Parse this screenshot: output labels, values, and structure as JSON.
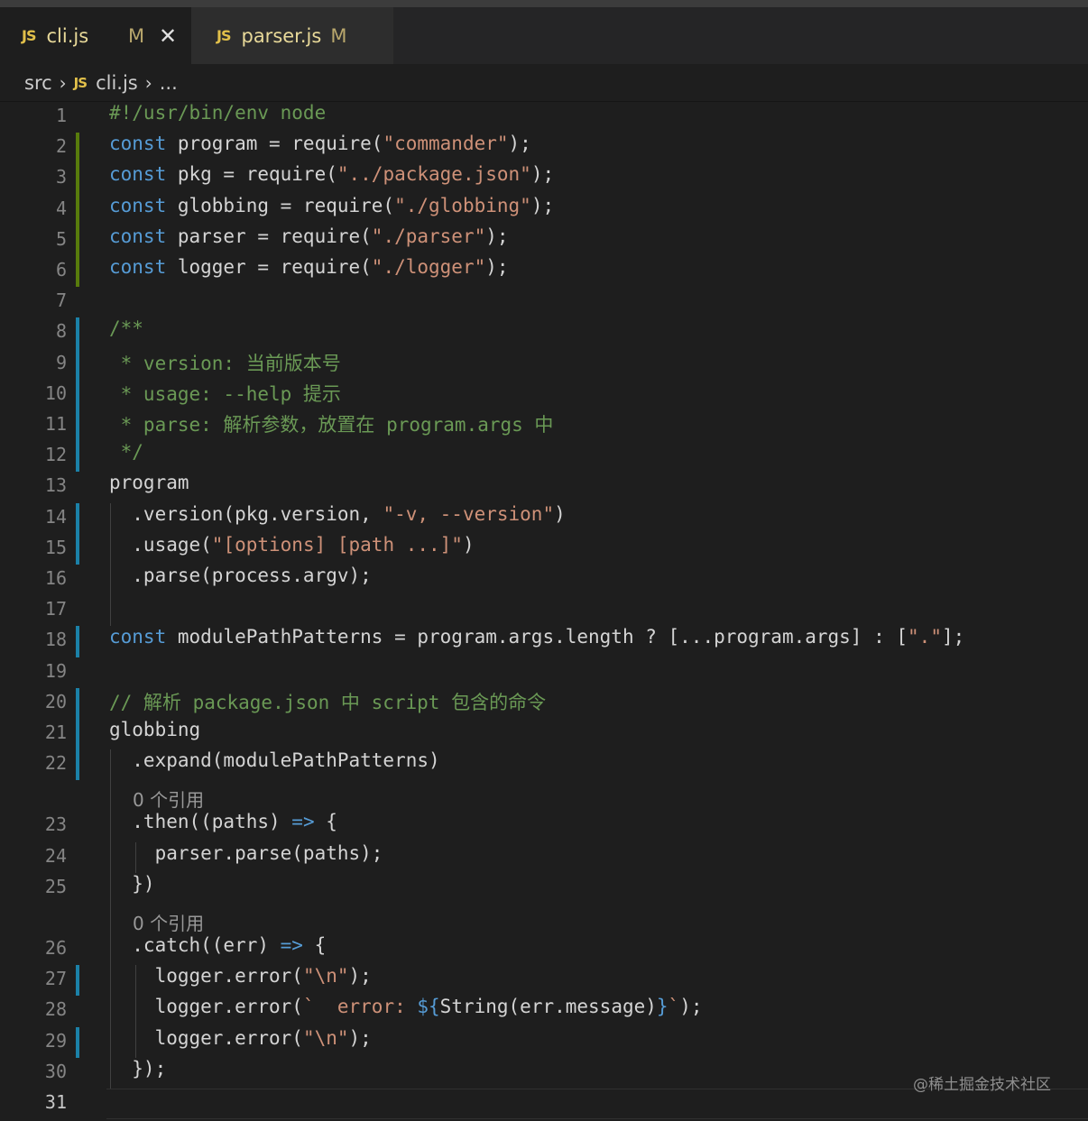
{
  "tabs": [
    {
      "icon": "JS",
      "label": "cli.js",
      "status": "M",
      "active": true
    },
    {
      "icon": "JS",
      "label": "parser.js",
      "status": "M",
      "active": false
    }
  ],
  "breadcrumb": {
    "folder": "src",
    "file": "cli.js",
    "more": "..."
  },
  "colors": {
    "keyword": "#569cd6",
    "string": "#ce9178",
    "comment": "#6a9955",
    "gutter_added": "#587c0c",
    "gutter_modified": "#1b81a8"
  },
  "editor": {
    "current_line": "31",
    "lines": [
      {
        "n": "1",
        "text": "#!/usr/bin/env node"
      },
      {
        "n": "2",
        "text": "const program = require(\"commander\");",
        "gutter": "added"
      },
      {
        "n": "3",
        "text": "const pkg = require(\"../package.json\");",
        "gutter": "added"
      },
      {
        "n": "4",
        "text": "const globbing = require(\"./globbing\");",
        "gutter": "added"
      },
      {
        "n": "5",
        "text": "const parser = require(\"./parser\");",
        "gutter": "added"
      },
      {
        "n": "6",
        "text": "const logger = require(\"./logger\");",
        "gutter": "added"
      },
      {
        "n": "7",
        "text": ""
      },
      {
        "n": "8",
        "text": "/**",
        "gutter": "modified"
      },
      {
        "n": "9",
        "text": " * version: 当前版本号",
        "gutter": "modified"
      },
      {
        "n": "10",
        "text": " * usage: --help 提示",
        "gutter": "modified"
      },
      {
        "n": "11",
        "text": " * parse: 解析参数，放置在 program.args 中",
        "gutter": "modified"
      },
      {
        "n": "12",
        "text": " */",
        "gutter": "modified"
      },
      {
        "n": "13",
        "text": "program"
      },
      {
        "n": "14",
        "text": "  .version(pkg.version, \"-v, --version\")",
        "gutter": "modified"
      },
      {
        "n": "15",
        "text": "  .usage(\"[options] [path ...]\")",
        "gutter": "modified"
      },
      {
        "n": "16",
        "text": "  .parse(process.argv);"
      },
      {
        "n": "17",
        "text": ""
      },
      {
        "n": "18",
        "text": "const modulePathPatterns = program.args.length ? [...program.args] : [\".\"];",
        "gutter": "modified"
      },
      {
        "n": "19",
        "text": ""
      },
      {
        "n": "20",
        "text": "// 解析 package.json 中 script 包含的命令",
        "gutter": "modified"
      },
      {
        "n": "21",
        "text": "globbing",
        "gutter": "modified"
      },
      {
        "n": "22",
        "text": "  .expand(modulePathPatterns)",
        "gutter": "modified"
      },
      {
        "n": "23",
        "text": "  .then((paths) => {",
        "codelens": "0 个引用"
      },
      {
        "n": "24",
        "text": "    parser.parse(paths);"
      },
      {
        "n": "25",
        "text": "  })"
      },
      {
        "n": "26",
        "text": "  .catch((err) => {",
        "codelens": "0 个引用"
      },
      {
        "n": "27",
        "text": "    logger.error(\"\\n\");",
        "gutter": "modified"
      },
      {
        "n": "28",
        "text": "    logger.error(`  error: ${String(err.message)}`);"
      },
      {
        "n": "29",
        "text": "    logger.error(\"\\n\");",
        "gutter": "modified"
      },
      {
        "n": "30",
        "text": "  });"
      },
      {
        "n": "31",
        "text": ""
      }
    ]
  },
  "watermark": "@稀土掘金技术社区"
}
